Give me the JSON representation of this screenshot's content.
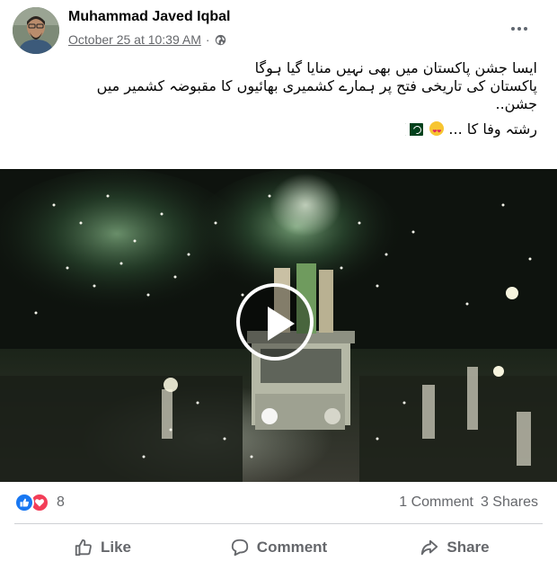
{
  "post": {
    "author_name": "Muhammad Javed Iqbal",
    "timestamp": "October 25 at 10:39 AM",
    "separator": "·",
    "privacy_icon": "globe-icon",
    "more_icon": "more-options-icon",
    "text_lines": [
      "ایسا جشن پاکستان میں بھی نہیں منایا گیا ہوگا",
      "پاکستان کی تاریخی فتح پر ہمارے کشمیری بھائیوں کا مقبوضہ کشمیر میں",
      "جشن.."
    ],
    "text_last_line": "رشتہ وفا کا ...",
    "emojis": [
      "pakistan-flag-icon",
      "heart-eyes-emoji"
    ]
  },
  "video": {
    "play_icon": "play-icon",
    "description_icon": "video-thumbnail"
  },
  "stats": {
    "reaction_icons": [
      "like-reaction-icon",
      "love-reaction-icon"
    ],
    "reaction_count": "8",
    "comments": "1 Comment",
    "shares": "3 Shares"
  },
  "actions": {
    "like": "Like",
    "comment": "Comment",
    "share": "Share"
  },
  "colors": {
    "like_blue": "#1877f2",
    "love_red": "#f33e58",
    "secondary_text": "#65676b",
    "divider": "#ced0d4"
  }
}
